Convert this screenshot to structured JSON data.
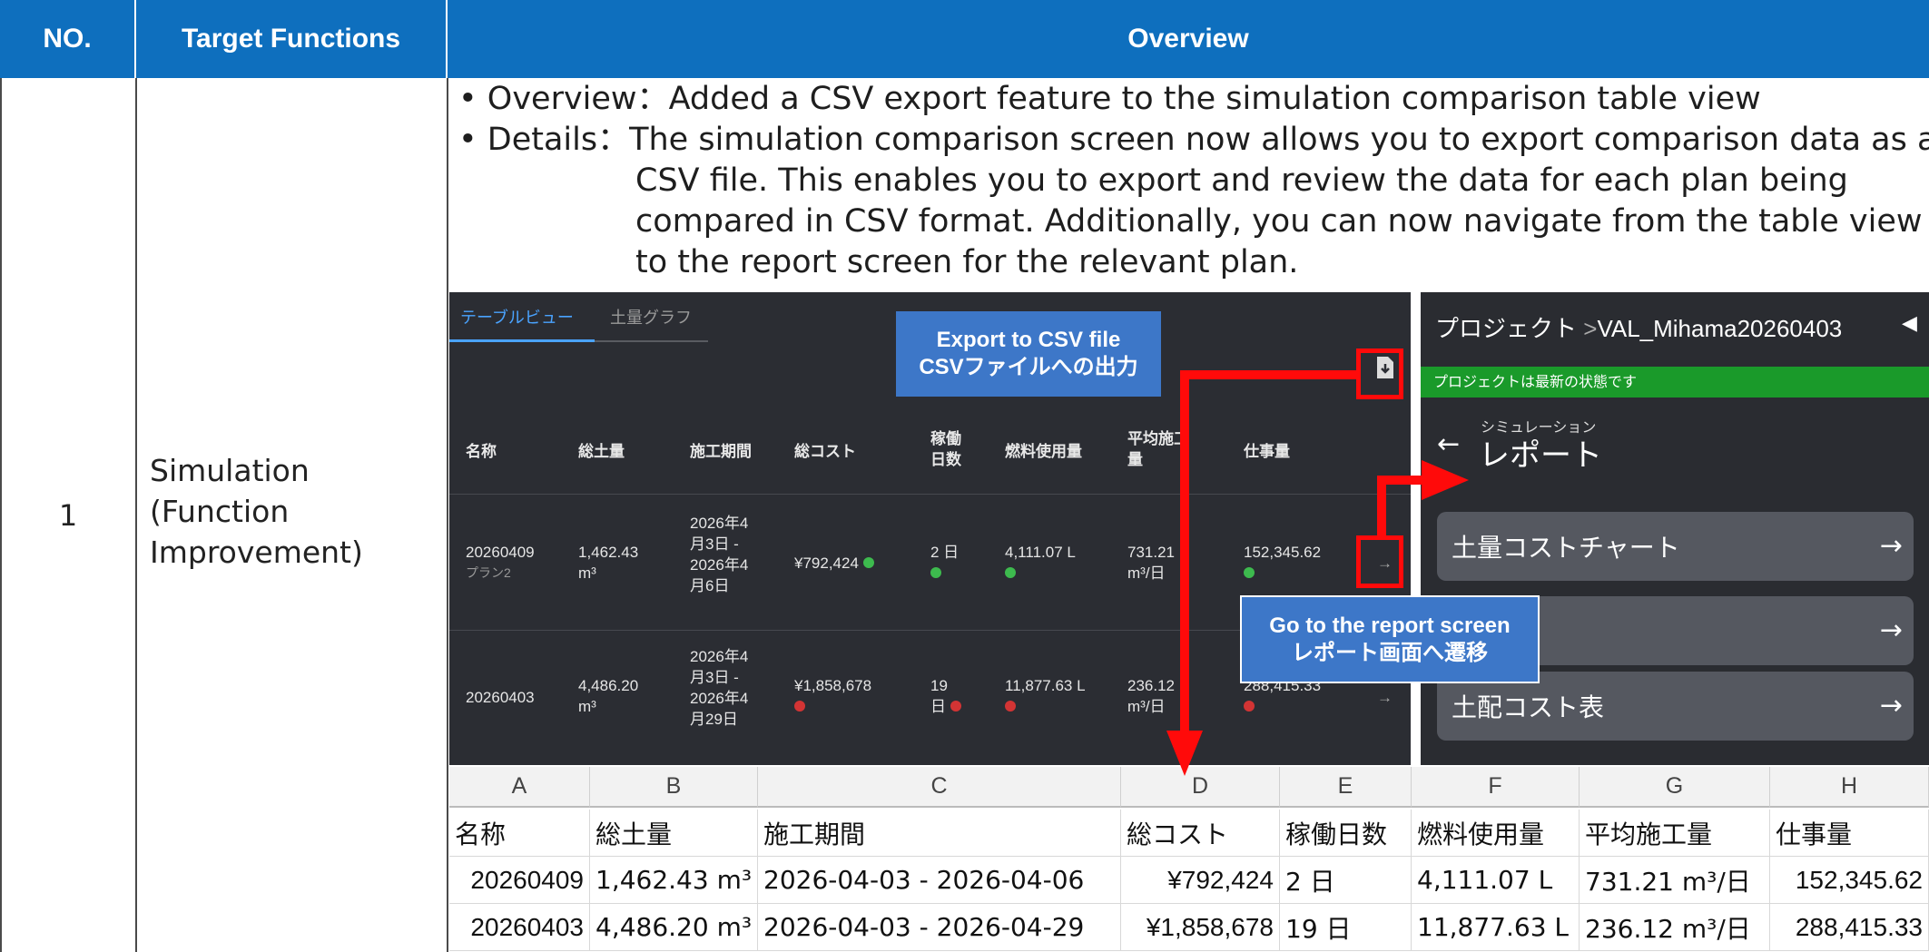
{
  "header": {
    "no": "NO.",
    "target_functions": "Target Functions",
    "overview": "Overview"
  },
  "row": {
    "no": "1",
    "target_function_lines": [
      "Simulation",
      "(Function",
      "Improvement)"
    ]
  },
  "bullets": {
    "overview_label": "• Overview：",
    "overview_text": "Added a CSV export feature to the simulation comparison table view",
    "details_label": "• Details：",
    "details_lines": [
      "The simulation comparison screen now allows you to export comparison data as a",
      "CSV file. This enables you to export and review the data for each plan being",
      "compared in CSV format. Additionally, you can now navigate from the table view",
      "to the report screen for the relevant plan."
    ]
  },
  "table_view": {
    "tabs": [
      "テーブルビュー",
      "土量グラフ"
    ],
    "headers": {
      "name": "名称",
      "soil": "総土量",
      "period": "施工期間",
      "cost": "総コスト",
      "days": "稼働日数",
      "days_l1": "稼働",
      "days_l2": "日数",
      "fuel": "燃料使用量",
      "avg_l1": "平均施工",
      "avg_l2": "量",
      "work": "仕事量"
    },
    "rows": [
      {
        "name": "20260409",
        "plan": "プラン2",
        "soil_l1": "1,462.43",
        "soil_l2": "m³",
        "period_l1": "2026年4",
        "period_l2": "月3日 -",
        "period_l3": "2026年4",
        "period_l4": "月6日",
        "cost": "¥792,424",
        "days": "2 日",
        "fuel": "4,111.07 L",
        "avg_l1": "731.21",
        "avg_l2": "m³/日",
        "work": "152,345.62",
        "status": "green"
      },
      {
        "name": "20260403",
        "plan": "",
        "soil_l1": "4,486.20",
        "soil_l2": "m³",
        "period_l1": "2026年4",
        "period_l2": "月3日 -",
        "period_l3": "2026年4",
        "period_l4": "月29日",
        "cost": "¥1,858,678",
        "days": "19",
        "days_l2": "日",
        "fuel": "11,877.63 L",
        "avg_l1": "236.12",
        "avg_l2": "m³/日",
        "work": "288,415.33",
        "status": "red"
      }
    ],
    "arrow": "→",
    "export_icon": "file-download-icon"
  },
  "report_panel": {
    "breadcrumb_root": "プロジェクト",
    "breadcrumb_sep": ">",
    "breadcrumb_project": "VAL_Mihama20260403",
    "collapse_icon": "◀",
    "status": "プロジェクトは最新の状態です",
    "back_arrow": "←",
    "subtitle": "シミュレーション",
    "title": "レポート",
    "buttons": [
      "土量コストチャート",
      "",
      "土配コスト表"
    ],
    "arrow": "→"
  },
  "callouts": {
    "export_l1": "Export to CSV file",
    "export_l2": "CSVファイルへの出力",
    "report_l1": "Go to the report screen",
    "report_l2": "レポート画面へ遷移"
  },
  "spreadsheet": {
    "columns": [
      "A",
      "B",
      "C",
      "D",
      "E",
      "F",
      "G",
      "H"
    ],
    "header_row": [
      "名称",
      "総土量",
      "施工期間",
      "総コスト",
      "稼働日数",
      "燃料使用量",
      "平均施工量",
      "仕事量"
    ],
    "rows": [
      [
        "20260409",
        "1,462.43 m³",
        "2026-04-03 - 2026-04-06",
        "¥792,424",
        "2 日",
        "4,111.07 L",
        "731.21 m³/日",
        "152,345.62"
      ],
      [
        "20260403",
        "4,486.20 m³",
        "2026-04-03 - 2026-04-29",
        "¥1,858,678",
        "19 日",
        "11,877.63 L",
        "236.12 m³/日",
        "288,415.33"
      ]
    ]
  },
  "colors": {
    "header_blue": "#0e6fbe",
    "callout_blue": "#3d77c8",
    "highlight_red": "#ff0a0a",
    "status_green": "#1a9a2a",
    "tab_active": "#4aa3ff"
  }
}
